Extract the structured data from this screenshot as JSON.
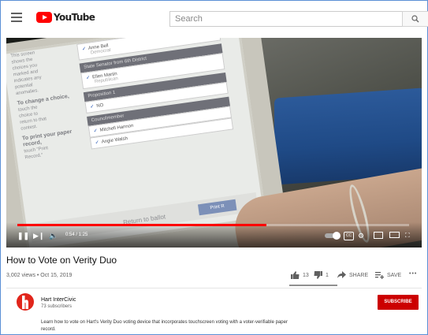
{
  "header": {
    "logo_text": "YouTube",
    "search_placeholder": "Search"
  },
  "video": {
    "screen": {
      "sidebar_lines": [
        "This screen",
        "shows the",
        "choices you",
        "marked and",
        "indicates any",
        "potential",
        "anomalies."
      ],
      "change_heading": "To change a choice,",
      "change_lines": [
        "touch the",
        "choice to",
        "return to that",
        "contest."
      ],
      "print_heading": "To print your paper record,",
      "print_lines": [
        "touch \"Print",
        "Record.\""
      ],
      "ballot": [
        {
          "type": "item",
          "label": "Anne Bell",
          "sub": "Democrat"
        },
        {
          "type": "head",
          "label": "State Senator from 6th District"
        },
        {
          "type": "item",
          "label": "Ellen Martin",
          "sub": "Republican"
        },
        {
          "type": "head",
          "label": "Proposition 1"
        },
        {
          "type": "item",
          "label": "NO",
          "sub": ""
        },
        {
          "type": "head",
          "label": "Councilmember"
        },
        {
          "type": "item",
          "label": "Mitchell Hannon",
          "sub": ""
        },
        {
          "type": "item",
          "label": "Angie Walsh",
          "sub": ""
        }
      ],
      "return_label": "Return to ballot",
      "print_button": "Print R"
    },
    "time_display": "0:54 / 1:25",
    "progress_fraction": 0.635,
    "cc_label": "CC"
  },
  "info": {
    "title": "How to Vote on Verity Duo",
    "stats": "3,002 views • Oct 15, 2019",
    "likes": "13",
    "dislikes": "1",
    "share_label": "SHARE",
    "save_label": "SAVE",
    "more_label": "•••"
  },
  "channel": {
    "name": "Hart InterCivic",
    "subscribers": "73 subscribers",
    "subscribe_label": "SUBSCRIBE",
    "description": "Learn how to vote on Hart's Verity Duo voting device that incorporates touchscreen voting with a voter-verifiable paper record."
  },
  "colors": {
    "accent": "#ff0000",
    "subscribe": "#cc0000",
    "frame": "#5b8fd6"
  }
}
